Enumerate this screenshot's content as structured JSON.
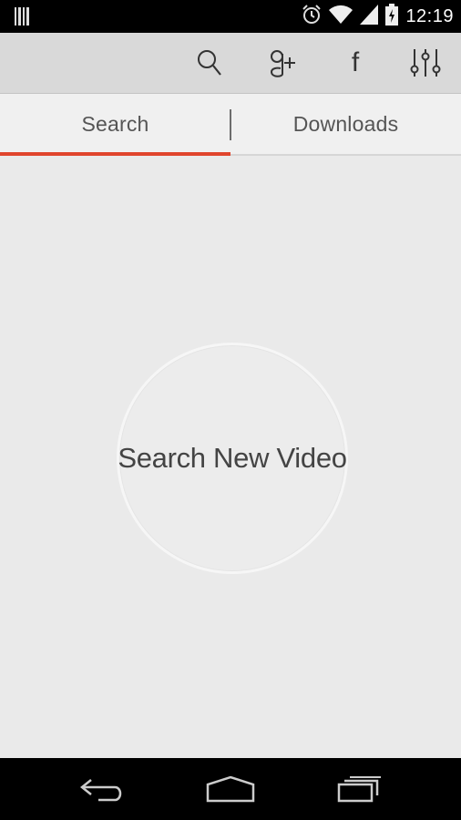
{
  "status_bar": {
    "time": "12:19",
    "icons": [
      "barcode-notification-icon",
      "alarm-icon",
      "wifi-icon",
      "signal-icon",
      "battery-charging-icon"
    ]
  },
  "action_bar": {
    "icons": [
      "search-icon",
      "google-plus-icon",
      "facebook-icon",
      "settings-sliders-icon"
    ],
    "facebook_glyph": "f"
  },
  "tabs": [
    {
      "label": "Search",
      "selected": true
    },
    {
      "label": "Downloads",
      "selected": false
    }
  ],
  "main": {
    "circle_button_label": "Search New Video"
  },
  "nav_bar": {
    "icons": [
      "back-icon",
      "home-icon",
      "recent-apps-icon"
    ]
  },
  "colors": {
    "accent": "#e0452d",
    "background": "#eaeaea",
    "action_bar": "#d9d9d9"
  }
}
